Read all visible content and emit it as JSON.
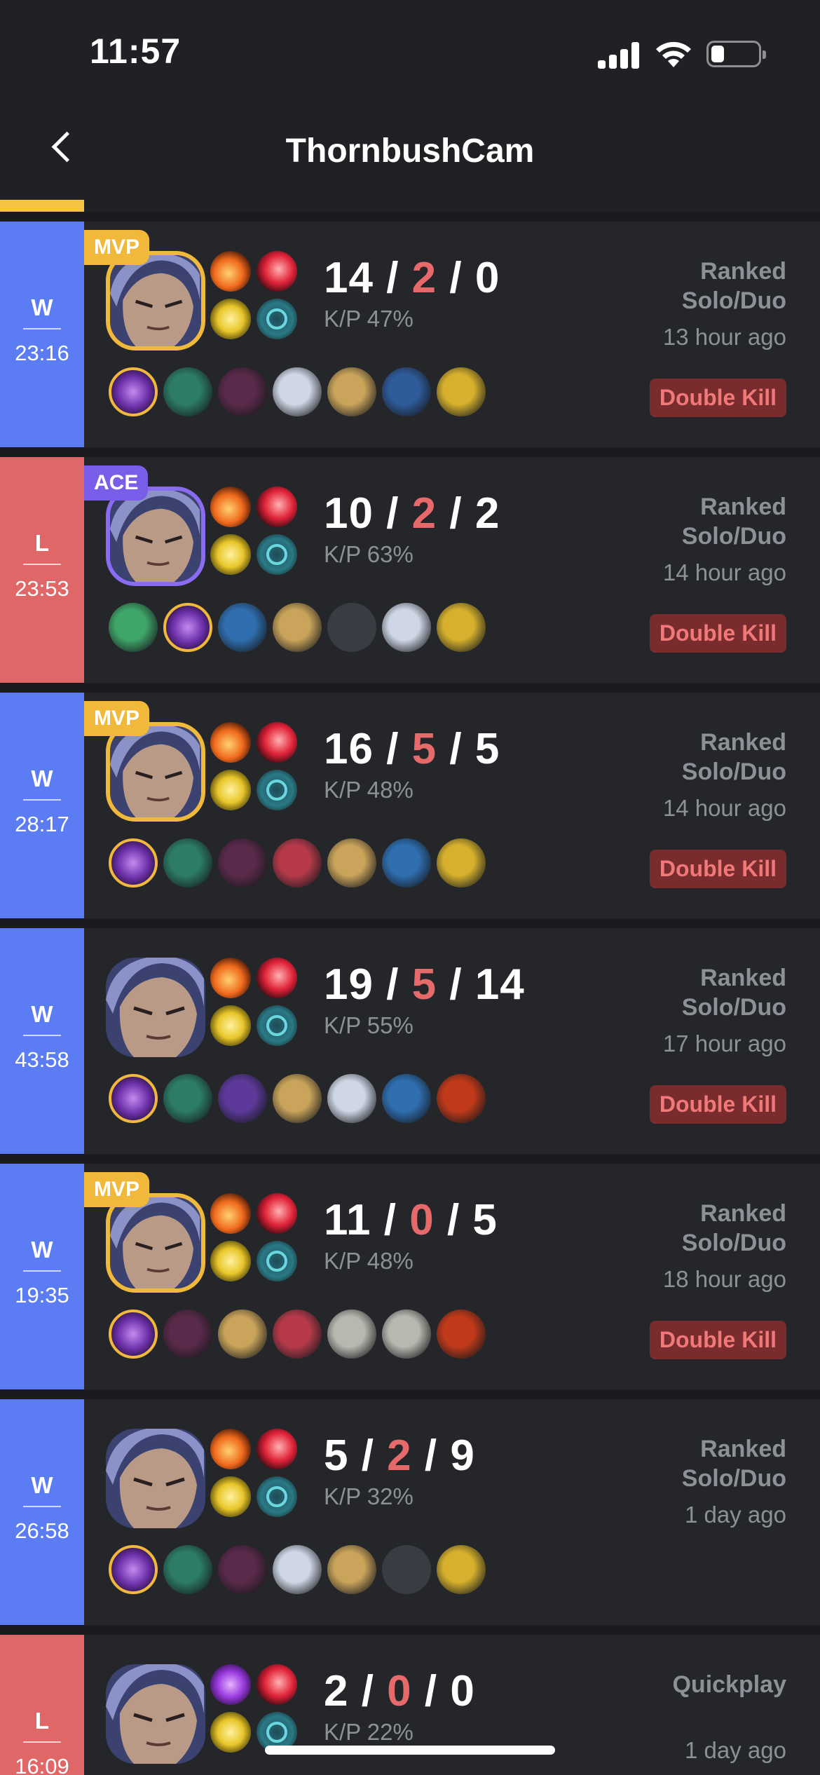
{
  "status_bar": {
    "time": "11:57"
  },
  "header": {
    "title": "ThornbushCam"
  },
  "matches": [
    {
      "result": "W",
      "duration": "23:16",
      "badge": "MVP",
      "kills": "14",
      "deaths": "2",
      "assists": "0",
      "kp": "K/P 47%",
      "queue": "Ranked Solo/Duo",
      "ago": "13 hour ago",
      "tag": "Double Kill"
    },
    {
      "result": "L",
      "duration": "23:53",
      "badge": "ACE",
      "kills": "10",
      "deaths": "2",
      "assists": "2",
      "kp": "K/P 63%",
      "queue": "Ranked Solo/Duo",
      "ago": "14 hour ago",
      "tag": "Double Kill"
    },
    {
      "result": "W",
      "duration": "28:17",
      "badge": "MVP",
      "kills": "16",
      "deaths": "5",
      "assists": "5",
      "kp": "K/P 48%",
      "queue": "Ranked Solo/Duo",
      "ago": "14 hour ago",
      "tag": "Double Kill"
    },
    {
      "result": "W",
      "duration": "43:58",
      "badge": "",
      "kills": "19",
      "deaths": "5",
      "assists": "14",
      "kp": "K/P 55%",
      "queue": "Ranked Solo/Duo",
      "ago": "17 hour ago",
      "tag": "Double Kill"
    },
    {
      "result": "W",
      "duration": "19:35",
      "badge": "MVP",
      "kills": "11",
      "deaths": "0",
      "assists": "5",
      "kp": "K/P 48%",
      "queue": "Ranked Solo/Duo",
      "ago": "18 hour ago",
      "tag": "Double Kill"
    },
    {
      "result": "W",
      "duration": "26:58",
      "badge": "",
      "kills": "5",
      "deaths": "2",
      "assists": "9",
      "kp": "K/P 32%",
      "queue": "Ranked Solo/Duo",
      "ago": "1 day ago",
      "tag": ""
    },
    {
      "result": "L",
      "duration": "16:09",
      "badge": "",
      "kills": "2",
      "deaths": "0",
      "assists": "0",
      "kp": "K/P 22%",
      "queue": "Quickplay",
      "ago": "1 day ago",
      "tag": ""
    }
  ]
}
